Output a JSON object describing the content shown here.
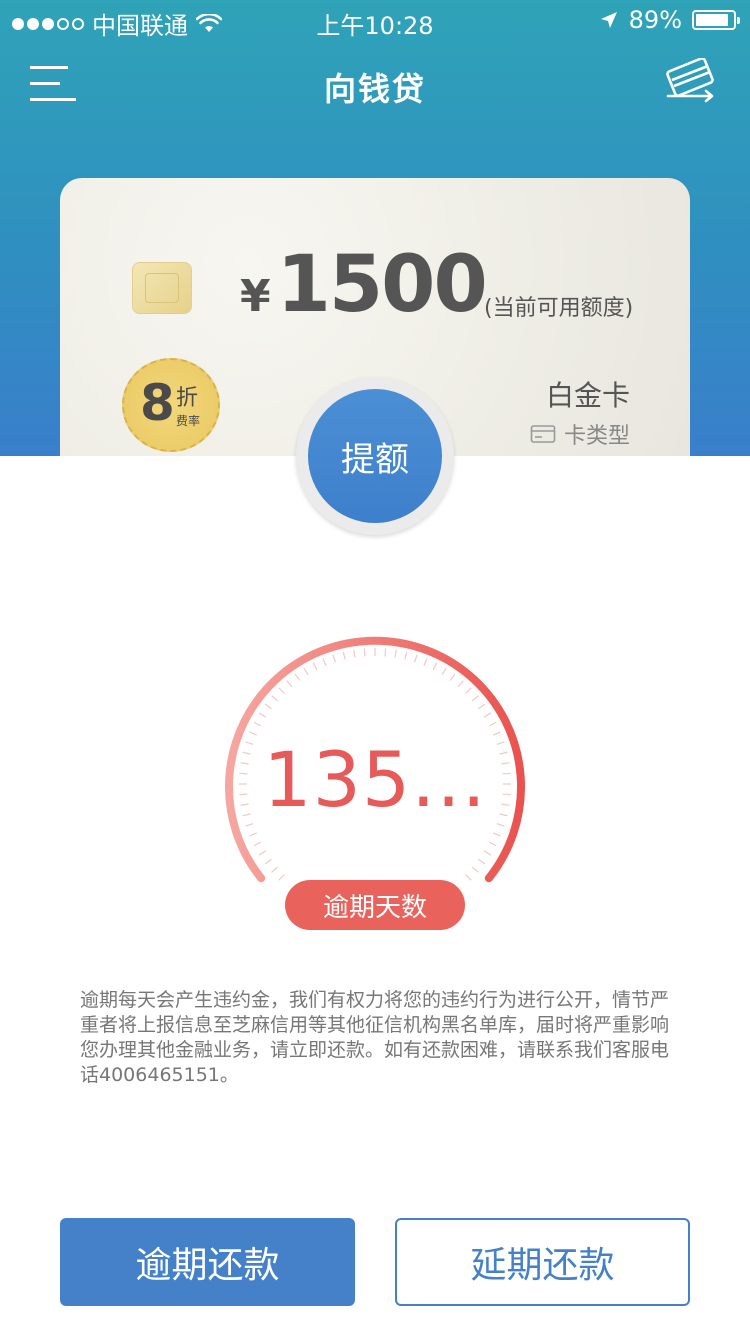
{
  "status_bar": {
    "carrier": "中国联通",
    "time": "上午10:28",
    "battery_text": "89%",
    "battery_level": 0.89,
    "signal_dots_filled": 3,
    "signal_dots_total": 5,
    "icons": [
      "wifi-icon",
      "location-arrow-icon",
      "battery-icon"
    ]
  },
  "nav": {
    "title": "向钱贷",
    "left_icon": "menu-icon",
    "right_icon": "card-switch-icon"
  },
  "card": {
    "currency_symbol": "¥",
    "amount": "1500",
    "amount_label": "(当前可用额度)",
    "discount_number": "8",
    "discount_unit": "折",
    "discount_sub": "费率",
    "type_name": "白金卡",
    "type_label": "卡类型"
  },
  "raise_button": {
    "label": "提额"
  },
  "gauge": {
    "value": "135...",
    "badge": "逾期天数"
  },
  "notice": "逾期每天会产生违约金，我们有权力将您的违约行为进行公开，情节严重者将上报信息至芝麻信用等其他征信机构黑名单库，届时将严重影响您办理其他金融业务，请立即还款。如有还款困难，请联系我们客服电话4006465151。",
  "buttons": {
    "repay": "逾期还款",
    "extend": "延期还款"
  },
  "colors": {
    "header_blue": "#2f8fc0",
    "button_blue": "#4581c8",
    "accent_red": "#e65a5a",
    "badge_gold": "#e9c862"
  }
}
